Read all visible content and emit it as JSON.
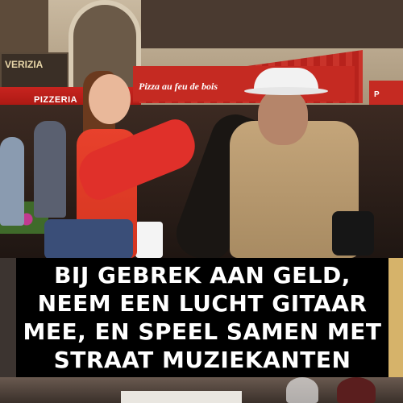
{
  "scene": {
    "shop_sign_text": "VERIZIA",
    "awning_left_text": "PIZZERIA",
    "awning_main_text": "Pizza au feu de bois",
    "awning_right_text": "P"
  },
  "caption": {
    "text": "BIJ GEBREK AAN GELD, NEEM EEN LUCHT GITAAR MEE, EN SPEEL SAMEN MET STRAAT MUZIEKANTEN"
  },
  "colors": {
    "caption_background": "#000000",
    "caption_text": "#ffffff",
    "awning_red": "#c52a22"
  }
}
